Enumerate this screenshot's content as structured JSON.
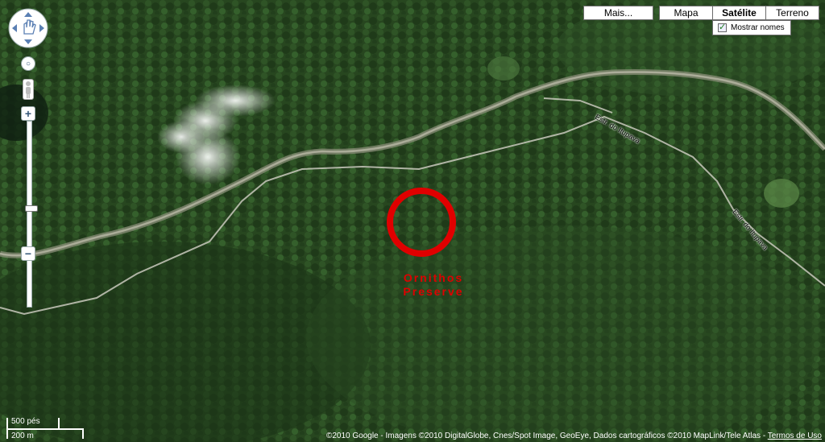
{
  "map_type_buttons": {
    "mais": "Mais...",
    "mapa": "Mapa",
    "satelite": "Satélite",
    "terreno": "Terreno"
  },
  "show_names": {
    "label": "Mostrar nomes",
    "checked": true
  },
  "roads": {
    "road_1": "Estr. do Itupava",
    "road_2": "Estr. do Itupava"
  },
  "marker": {
    "label_line1": "Ornithos",
    "label_line2": "Preserve",
    "color": "#e00000"
  },
  "scale": {
    "imperial": "500 pés",
    "metric": "200 m"
  },
  "footer": {
    "copyright": "©2010 Google - Imagens ©2010 DigitalGlobe, Cnes/Spot Image, GeoEye, Dados cartográficos ©2010 MapLink/Tele Atlas - ",
    "terms": "Termos de Uso"
  },
  "zoom": {
    "in": "+",
    "out": "−"
  }
}
